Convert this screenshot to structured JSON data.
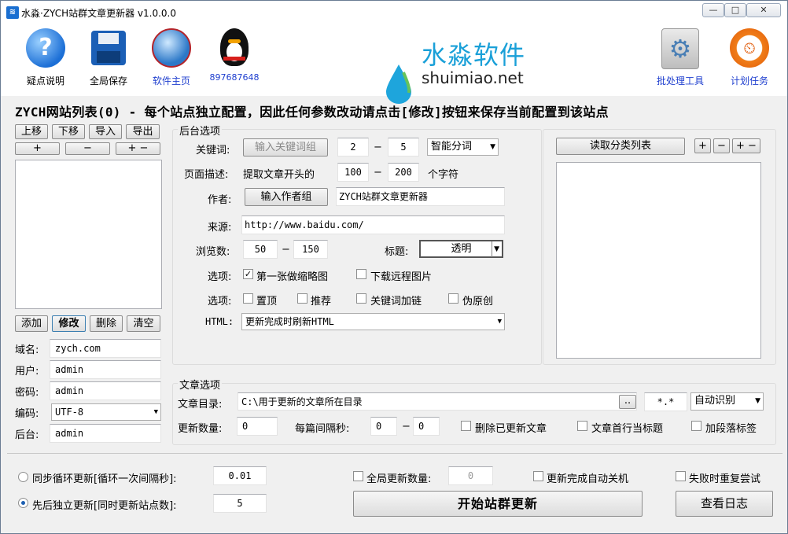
{
  "window": {
    "title": "水淼·ZYCH站群文章更新器 v1.0.0.0",
    "app_icon": "water-drop-icon",
    "min": "—",
    "max": "□",
    "close": "✕"
  },
  "toolbar": [
    {
      "label": "疑点说明",
      "icon": "help-icon",
      "color": "#000"
    },
    {
      "label": "全局保存",
      "icon": "floppy-save-icon",
      "color": "#000"
    },
    {
      "label": "软件主页",
      "icon": "globe-icon",
      "color": "#1f3fcf"
    },
    {
      "label": "897687648",
      "icon": "qq-penguin-icon",
      "color": "#1f3fcf"
    }
  ],
  "brand": {
    "cn": "水淼软件",
    "en": "shuimiao.net"
  },
  "right_tools": [
    {
      "label": "批处理工具",
      "icon": "gear-icon"
    },
    {
      "label": "计划任务",
      "icon": "clock-icon"
    }
  ],
  "site_list": {
    "header": "ZYCH网站列表(0) - 每个站点独立配置，因此任何参数改动请点击[修改]按钮来保存当前配置到该站点",
    "move_up": "上移",
    "move_down": "下移",
    "import": "导入",
    "export": "导出",
    "plus": "+",
    "minus": "−",
    "plusminus": "+ −",
    "add": "添加",
    "modify": "修改",
    "delete": "删除",
    "clear": "清空"
  },
  "site_fields": {
    "domain_label": "域名:",
    "domain": "zych.com",
    "user_label": "用户:",
    "user": "admin",
    "pass_label": "密码:",
    "pass": "admin",
    "enc_label": "编码:",
    "enc": "UTF-8",
    "backend_label": "后台:",
    "backend": "admin"
  },
  "backend": {
    "title": "后台选项",
    "kw_label": "关键词:",
    "kw_btn": "输入关键词组",
    "kw_min": "2",
    "kw_max": "5",
    "kw_mode": "智能分词",
    "desc_label": "页面描述:",
    "desc_prefix": "提取文章开头的",
    "desc_min": "100",
    "desc_max": "200",
    "desc_suffix": "个字符",
    "author_label": "作者:",
    "author_btn": "输入作者组",
    "author_val": "ZYCH站群文章更新器",
    "source_label": "来源:",
    "source_val": "http://www.baidu.com/",
    "views_label": "浏览数:",
    "views_min": "50",
    "views_max": "150",
    "title_label": "标题:",
    "title_val": "透明",
    "opt1_label": "选项:",
    "opt1a": "第一张做缩略图",
    "opt1b": "下载远程图片",
    "opt2_label": "选项:",
    "opt2a": "置顶",
    "opt2b": "推荐",
    "opt2c": "关键词加链",
    "opt2d": "伪原创",
    "html_label": "HTML:",
    "html_val": "更新完成时刷新HTML",
    "dash": "−"
  },
  "category": {
    "read_btn": "读取分类列表",
    "plus": "+",
    "minus": "−",
    "plusminus": "+ −"
  },
  "article": {
    "title": "文章选项",
    "dir_label": "文章目录:",
    "dir_val": "C:\\用于更新的文章所在目录",
    "browse": "..",
    "ext": "*.*",
    "enc": "自动识别",
    "count_label": "更新数量:",
    "count_val": "0",
    "interval_label": "每篇间隔秒:",
    "int_min": "0",
    "int_max": "0",
    "del_label": "删除已更新文章",
    "first_line": "文章首行当标题",
    "para_tag": "加段落标签"
  },
  "bottom": {
    "sync_label": "同步循环更新[循环一次间隔秒]:",
    "sync_val": "0.01",
    "seq_label": "先后独立更新[同时更新站点数]:",
    "seq_val": "5",
    "global_label": "全局更新数量:",
    "global_val": "0",
    "shutdown": "更新完成自动关机",
    "retry": "失败时重复尝试",
    "start": "开始站群更新",
    "log": "查看日志"
  }
}
